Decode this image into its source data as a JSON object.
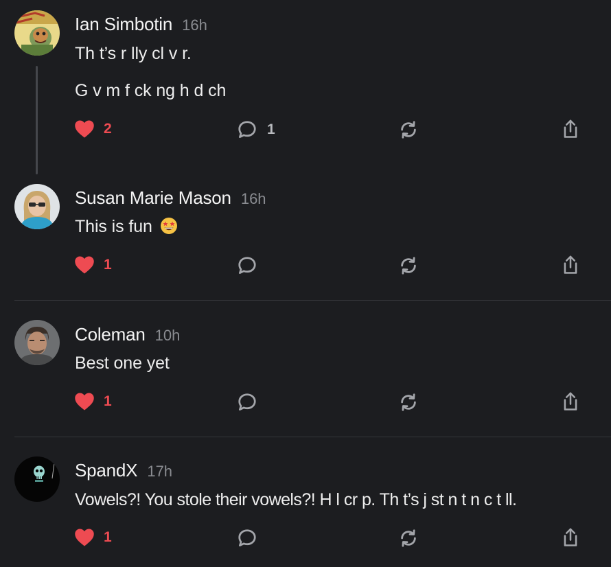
{
  "colors": {
    "background": "#1c1d20",
    "like": "#ee4b52",
    "muted": "#8a8c91",
    "icon": "#a4a6ab",
    "divider": "#34363a"
  },
  "icons": {
    "like": "heart-icon",
    "reply": "speech-bubble-icon",
    "restack": "repost-icon",
    "share": "share-icon"
  },
  "comments": [
    {
      "author": "Ian Simbotin",
      "time": "16h",
      "lines": [
        "Th t’s r lly cl v r.",
        "G v m f ck ng h d ch"
      ],
      "likes": "2",
      "replies": "1"
    },
    {
      "author": "Susan Marie Mason",
      "time": "16h",
      "lines": [
        "This is fun"
      ],
      "emoji": "star-struck-emoji",
      "likes": "1",
      "replies": ""
    },
    {
      "author": "Coleman",
      "time": "10h",
      "lines": [
        "Best one yet"
      ],
      "likes": "1",
      "replies": ""
    },
    {
      "author": "SpandX",
      "time": "17h",
      "lines": [
        "Vowels?! You stole their vowels?! H l cr p. Th t’s j st n t n c t ll."
      ],
      "likes": "1",
      "replies": ""
    }
  ]
}
